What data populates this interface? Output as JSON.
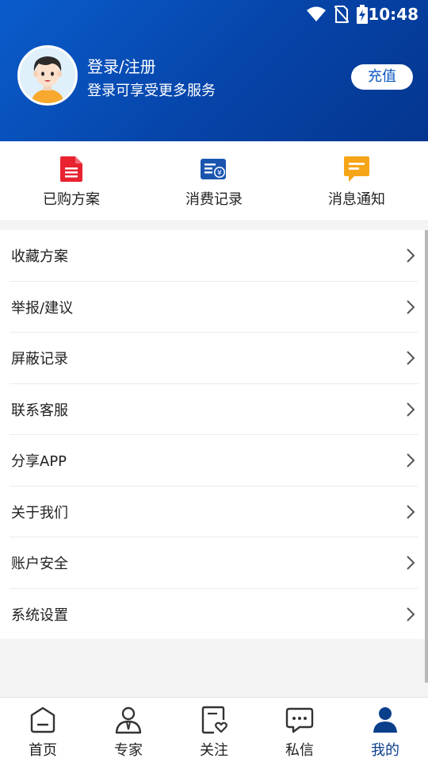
{
  "status_bar": {
    "time": "10:48"
  },
  "profile": {
    "title": "登录/注册",
    "subtitle": "登录可享受更多服务",
    "recharge_label": "充值"
  },
  "quick_actions": [
    {
      "label": "已购方案",
      "icon": "document-icon",
      "color": "#e8232f"
    },
    {
      "label": "消费记录",
      "icon": "receipt-yen-icon",
      "color": "#1a55b0"
    },
    {
      "label": "消息通知",
      "icon": "message-icon",
      "color": "#f6a518"
    }
  ],
  "menu": {
    "items": [
      {
        "label": "收藏方案"
      },
      {
        "label": "举报/建议"
      },
      {
        "label": "屏蔽记录"
      },
      {
        "label": "联系客服"
      },
      {
        "label": "分享APP"
      },
      {
        "label": "关于我们"
      },
      {
        "label": "账户安全"
      },
      {
        "label": "系统设置"
      }
    ]
  },
  "tabs": [
    {
      "label": "首页",
      "icon": "home-icon"
    },
    {
      "label": "专家",
      "icon": "expert-icon"
    },
    {
      "label": "关注",
      "icon": "follow-icon"
    },
    {
      "label": "私信",
      "icon": "chat-icon"
    },
    {
      "label": "我的",
      "icon": "user-icon",
      "active": true
    }
  ],
  "colors": {
    "header": "#0644a8",
    "active_tab": "#0a3f8c"
  }
}
